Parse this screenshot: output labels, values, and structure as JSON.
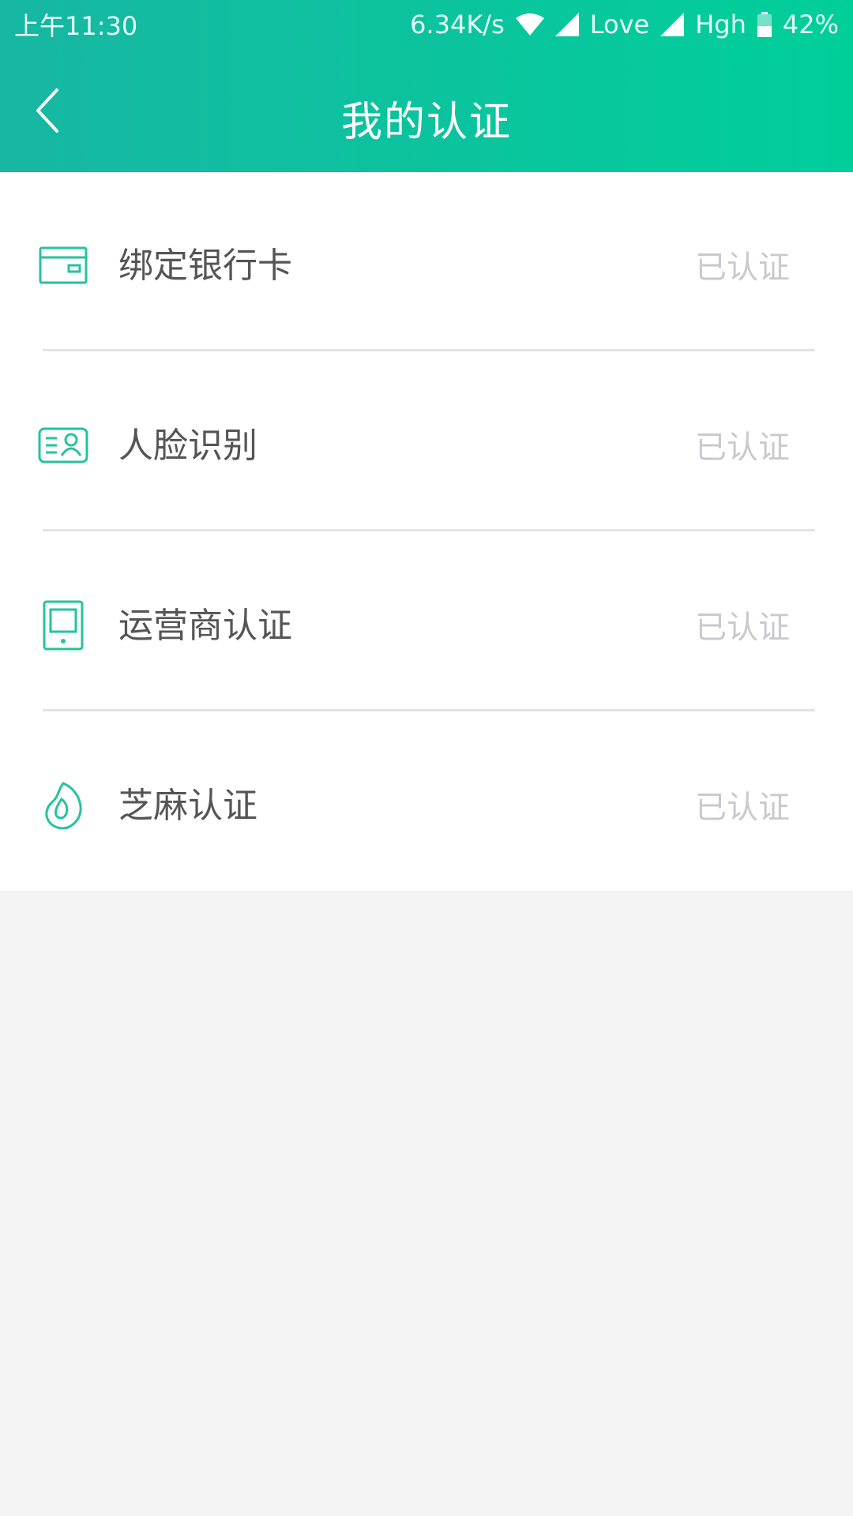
{
  "status_bar": {
    "time": "上午11:30",
    "speed": "6.34K/s",
    "carrier1": "Love",
    "carrier2": "Hgh",
    "battery": "42%"
  },
  "header": {
    "title": "我的认证",
    "back_icon": "chevron-left-icon"
  },
  "colors": {
    "header_start": "#17b7a2",
    "header_end": "#00cf9a",
    "icon_accent": "#24c3a0",
    "status_text": "#c9c9cf",
    "label_text": "#555555",
    "page_bg": "#f4f4f4"
  },
  "items": [
    {
      "label": "绑定银行卡",
      "status": "已认证",
      "icon": "bank-card-icon"
    },
    {
      "label": "人脸识别",
      "status": "已认证",
      "icon": "id-card-icon"
    },
    {
      "label": "运营商认证",
      "status": "已认证",
      "icon": "phone-icon"
    },
    {
      "label": "芝麻认证",
      "status": "已认证",
      "icon": "sesame-icon"
    }
  ]
}
